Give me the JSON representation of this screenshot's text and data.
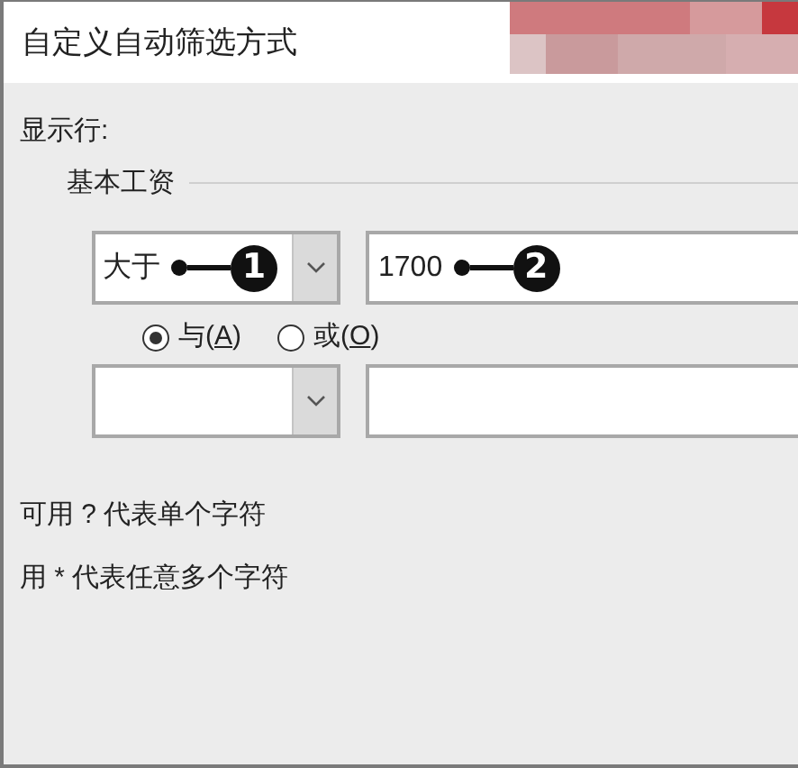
{
  "window": {
    "title": "自定义自动筛选方式"
  },
  "section_label": "显示行:",
  "field_name": "基本工资",
  "conditions": [
    {
      "kind": "condition",
      "operator": "大于",
      "value": "1700",
      "callouts": [
        "1",
        "2"
      ]
    },
    {
      "kind": "condition"
    }
  ],
  "logic": [
    {
      "label": "与(A)",
      "selected": true
    },
    {
      "label": "或(O)",
      "selected": false
    }
  ],
  "hints": [
    "可用 ? 代表单个字符",
    "用 * 代表任意多个字符"
  ]
}
